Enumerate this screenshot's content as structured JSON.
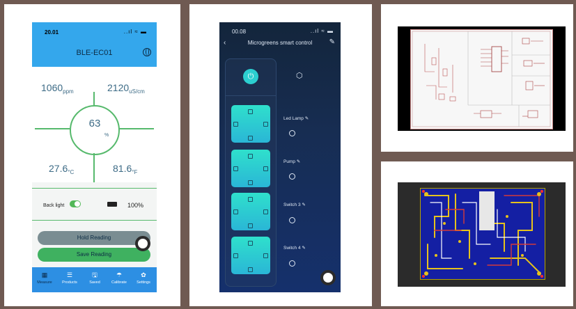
{
  "phone_ec": {
    "status_time": "20.01",
    "status_icons": "..ıl ≈ ▬",
    "header_title": "BLE-EC01",
    "ppm_value": "1060",
    "ppm_unit": "ppm",
    "us_value": "2120",
    "us_unit": "uS/cm",
    "center_value": "63",
    "center_unit": "%",
    "temp_c_value": "27.6",
    "temp_c_unit": "°C",
    "temp_f_value": "81.6",
    "temp_f_unit": "°F",
    "backlight_label": "Back light",
    "battery_percent": "100%",
    "hold_button": "Hold Reading",
    "save_button": "Save Reading",
    "tabs": [
      {
        "label": "Measure",
        "icon": "▦"
      },
      {
        "label": "Products",
        "icon": "☰"
      },
      {
        "label": "Saved",
        "icon": "🖫"
      },
      {
        "label": "Calibrate",
        "icon": "☂"
      },
      {
        "label": "Settings",
        "icon": "✿"
      }
    ]
  },
  "phone_microgreens": {
    "status_time": "00.08",
    "status_icons": "..ıl ≈ ▬",
    "back_glyph": "‹",
    "title": "Microgreens smart control",
    "edit_glyph": "✎",
    "switches": [
      {
        "label": "Led Lamp"
      },
      {
        "label": "Pump"
      },
      {
        "label": "Switch 3"
      },
      {
        "label": "Switch 4"
      }
    ],
    "edit_small": "✎",
    "power_glyph": "⏻",
    "cube_glyph": "⬡"
  },
  "schematic": {
    "icon": "schematic-image"
  },
  "pcb": {
    "icon": "pcb-layout-image"
  }
}
